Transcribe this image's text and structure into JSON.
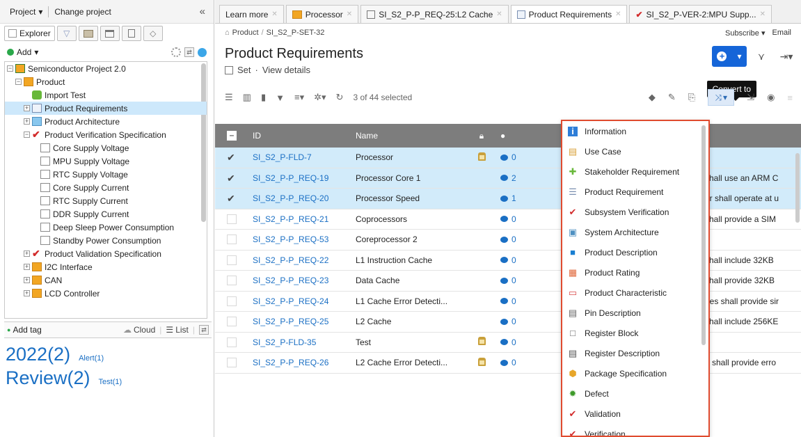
{
  "left": {
    "project_label": "Project",
    "change_project": "Change project",
    "explorer_tab": "Explorer",
    "add_label": "Add",
    "tree": [
      {
        "label": "Semiconductor Project 2.0",
        "indent": 0,
        "icon": "proj",
        "exp": "-"
      },
      {
        "label": "Product",
        "indent": 1,
        "icon": "folder",
        "exp": "-"
      },
      {
        "label": "Import Test",
        "indent": 2,
        "icon": "puzzle",
        "exp": ""
      },
      {
        "label": "Product Requirements",
        "indent": 2,
        "icon": "docs",
        "exp": "+",
        "selected": true
      },
      {
        "label": "Product Architecture",
        "indent": 2,
        "icon": "arch",
        "exp": "+"
      },
      {
        "label": "Product Verification Specification",
        "indent": 2,
        "icon": "check",
        "exp": "-"
      },
      {
        "label": "Core Supply Voltage",
        "indent": 3,
        "icon": "doc",
        "exp": ""
      },
      {
        "label": "MPU Supply Voltage",
        "indent": 3,
        "icon": "doc",
        "exp": ""
      },
      {
        "label": "RTC Supply Voltage",
        "indent": 3,
        "icon": "doc",
        "exp": ""
      },
      {
        "label": "Core Supply Current",
        "indent": 3,
        "icon": "doc",
        "exp": ""
      },
      {
        "label": "RTC Supply Current",
        "indent": 3,
        "icon": "doc",
        "exp": ""
      },
      {
        "label": "DDR Supply Current",
        "indent": 3,
        "icon": "doc",
        "exp": ""
      },
      {
        "label": "Deep Sleep Power Consumption",
        "indent": 3,
        "icon": "doc",
        "exp": ""
      },
      {
        "label": "Standby Power Consumption",
        "indent": 3,
        "icon": "doc",
        "exp": ""
      },
      {
        "label": "Product Validation Specification",
        "indent": 2,
        "icon": "check",
        "exp": "+"
      },
      {
        "label": "I2C Interface",
        "indent": 2,
        "icon": "folder",
        "exp": "+"
      },
      {
        "label": "CAN",
        "indent": 2,
        "icon": "folder",
        "exp": "+"
      },
      {
        "label": "LCD Controller",
        "indent": 2,
        "icon": "folder",
        "exp": "+"
      }
    ],
    "add_tag": "Add tag",
    "cloud": "Cloud",
    "list": "List",
    "tags": [
      {
        "big": "2022(2)",
        "small": "Alert(1)"
      },
      {
        "big": "Review(2)",
        "small": "Test(1)"
      }
    ]
  },
  "tabs": [
    {
      "label": "Learn more",
      "icon": ""
    },
    {
      "label": "Processor",
      "icon": "folder"
    },
    {
      "label": "SI_S2_P-P_REQ-25:L2 Cache",
      "icon": "doc"
    },
    {
      "label": "Product Requirements",
      "icon": "docs",
      "active": true
    },
    {
      "label": "SI_S2_P-VER-2:MPU Supp...",
      "icon": "check"
    }
  ],
  "breadcrumb": {
    "root": "Product",
    "current": "SI_S2_P-SET-32"
  },
  "subscribe": "Subscribe",
  "email": "Email",
  "title": "Product Requirements",
  "subline": {
    "set": "Set",
    "details": "View details"
  },
  "tooltip": "Convert to",
  "toolbar": {
    "selected": "3 of 44 selected"
  },
  "grid": {
    "headers": {
      "id": "ID",
      "name": "Name"
    },
    "rows": [
      {
        "id": "SI_S2_P-FLD-7",
        "name": "Processor",
        "lock": true,
        "comments": "0",
        "desc": "",
        "selected": true
      },
      {
        "id": "SI_S2_P-P_REQ-19",
        "name": "Processor Core 1",
        "lock": false,
        "comments": "2",
        "desc": "shall use an ARM C",
        "selected": true
      },
      {
        "id": "SI_S2_P-P_REQ-20",
        "name": "Processor Speed",
        "lock": false,
        "comments": "1",
        "desc": "or shall operate at u",
        "selected": true
      },
      {
        "id": "SI_S2_P-P_REQ-21",
        "name": "Coprocessors",
        "lock": false,
        "comments": "0",
        "desc": "shall provide a SIM",
        "selected": false
      },
      {
        "id": "SI_S2_P-P_REQ-53",
        "name": "Coreprocessor 2",
        "lock": false,
        "comments": "0",
        "desc": "",
        "selected": false
      },
      {
        "id": "SI_S2_P-P_REQ-22",
        "name": "L1 Instruction Cache",
        "lock": false,
        "comments": "0",
        "desc": "shall include 32KB",
        "selected": false
      },
      {
        "id": "SI_S2_P-P_REQ-23",
        "name": "Data Cache",
        "lock": false,
        "comments": "0",
        "desc": "shall provide 32KB",
        "selected": false
      },
      {
        "id": "SI_S2_P-P_REQ-24",
        "name": "L1 Cache Error Detecti...",
        "lock": false,
        "comments": "0",
        "desc": "hes shall provide sir",
        "selected": false
      },
      {
        "id": "SI_S2_P-P_REQ-25",
        "name": "L2 Cache",
        "lock": false,
        "comments": "0",
        "desc": "shall include 256KE",
        "selected": false
      },
      {
        "id": "SI_S2_P-FLD-35",
        "name": "Test",
        "lock": true,
        "comments": "0",
        "desc": "",
        "selected": false
      },
      {
        "id": "SI_S2_P-P_REQ-26",
        "name": "L2 Cache Error Detecti...",
        "lock": true,
        "comments": "0",
        "desc": "e shall provide erro",
        "selected": false
      }
    ]
  },
  "menu": [
    {
      "label": "Information",
      "icon": "info-icon",
      "color": "#2f7ed8"
    },
    {
      "label": "Use Case",
      "icon": "use-case-icon",
      "color": "#d9a23b"
    },
    {
      "label": "Stakeholder Requirement",
      "icon": "puzzle-icon",
      "color": "#68b83a"
    },
    {
      "label": "Product Requirement",
      "icon": "requirement-icon",
      "color": "#7a8fb1"
    },
    {
      "label": "Subsystem Verification",
      "icon": "check-icon",
      "color": "#d22a2a"
    },
    {
      "label": "System Architecture",
      "icon": "architecture-icon",
      "color": "#4d90c1"
    },
    {
      "label": "Product Description",
      "icon": "description-icon",
      "color": "#1a7fd1"
    },
    {
      "label": "Product Rating",
      "icon": "rating-icon",
      "color": "#e0683b"
    },
    {
      "label": "Product Characteristic",
      "icon": "characteristic-icon",
      "color": "#d84a4a"
    },
    {
      "label": "Pin Description",
      "icon": "pin-icon",
      "color": "#666666"
    },
    {
      "label": "Register Block",
      "icon": "register-block-icon",
      "color": "#666666"
    },
    {
      "label": "Register Description",
      "icon": "register-description-icon",
      "color": "#555555"
    },
    {
      "label": "Package Specification",
      "icon": "package-icon",
      "color": "#e7a62a"
    },
    {
      "label": "Defect",
      "icon": "defect-icon",
      "color": "#3e9a2a"
    },
    {
      "label": "Validation",
      "icon": "validation-icon",
      "color": "#d22a2a"
    },
    {
      "label": "Verification",
      "icon": "verification-icon",
      "color": "#d22a2a"
    }
  ]
}
